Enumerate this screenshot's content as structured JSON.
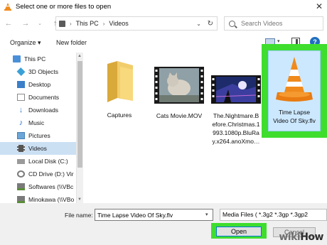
{
  "window": {
    "title": "Select one or more files to open",
    "close_glyph": "✕"
  },
  "address": {
    "breadcrumbs": [
      "This PC",
      "Videos"
    ]
  },
  "search": {
    "placeholder": "Search Videos"
  },
  "toolbar": {
    "organize_label": "Organize ▾",
    "new_folder_label": "New folder",
    "help_label": "?"
  },
  "nav": {
    "items": [
      {
        "label": "This PC",
        "icon": "computer-icon",
        "color": "#4a90d9"
      },
      {
        "label": "3D Objects",
        "icon": "3d-objects-icon",
        "color": "#3aa0d8"
      },
      {
        "label": "Desktop",
        "icon": "desktop-icon",
        "color": "#3a7fc8"
      },
      {
        "label": "Documents",
        "icon": "documents-icon",
        "color": "#8a8a8a"
      },
      {
        "label": "Downloads",
        "icon": "downloads-icon",
        "color": "#2f7fd0"
      },
      {
        "label": "Music",
        "icon": "music-icon",
        "color": "#2f6fd0"
      },
      {
        "label": "Pictures",
        "icon": "pictures-icon",
        "color": "#6aa6d8"
      },
      {
        "label": "Videos",
        "icon": "videos-icon",
        "color": "#555555",
        "selected": true
      },
      {
        "label": "Local Disk (C:)",
        "icon": "drive-icon",
        "color": "#7a7a7a"
      },
      {
        "label": "CD Drive (D:) Vir",
        "icon": "cd-drive-icon",
        "color": "#7a7a7a"
      },
      {
        "label": "Softwares (\\\\VBc",
        "icon": "network-drive-icon",
        "color": "#5b8d3a"
      },
      {
        "label": "Minokawa (\\\\VBo",
        "icon": "network-drive-icon",
        "color": "#5b8d3a"
      }
    ]
  },
  "files": [
    {
      "name": "Captures",
      "type": "folder"
    },
    {
      "name": "Cats Movie.MOV",
      "type": "video"
    },
    {
      "name": "The.Nightmare.Before.Christmas.1993.1080p.BluRay.x264.anoXmo…",
      "lines": [
        "The.Nightmare.B",
        "efore.Christmas.1",
        "993.1080p.BluRa",
        "y.x264.anoXmo…"
      ],
      "type": "video"
    },
    {
      "name": "Time Lapse Video Of Sky.flv",
      "lines": [
        "Time Lapse",
        "Video Of Sky.flv"
      ],
      "type": "flv",
      "selected": true
    }
  ],
  "bottom": {
    "file_name_label": "File name:",
    "file_name_value": "Time Lapse Video Of Sky.flv",
    "filter_value": "Media Files ( *.3g2 *.3gp *.3gp2",
    "open_label": "Open",
    "cancel_label": "Cancel"
  },
  "watermark": {
    "wiki": "wiki",
    "how": "How"
  },
  "colors": {
    "highlight_green": "#3fdd2e",
    "selection_blue": "#cce0f4",
    "vlc_orange": "#f08a1c"
  }
}
